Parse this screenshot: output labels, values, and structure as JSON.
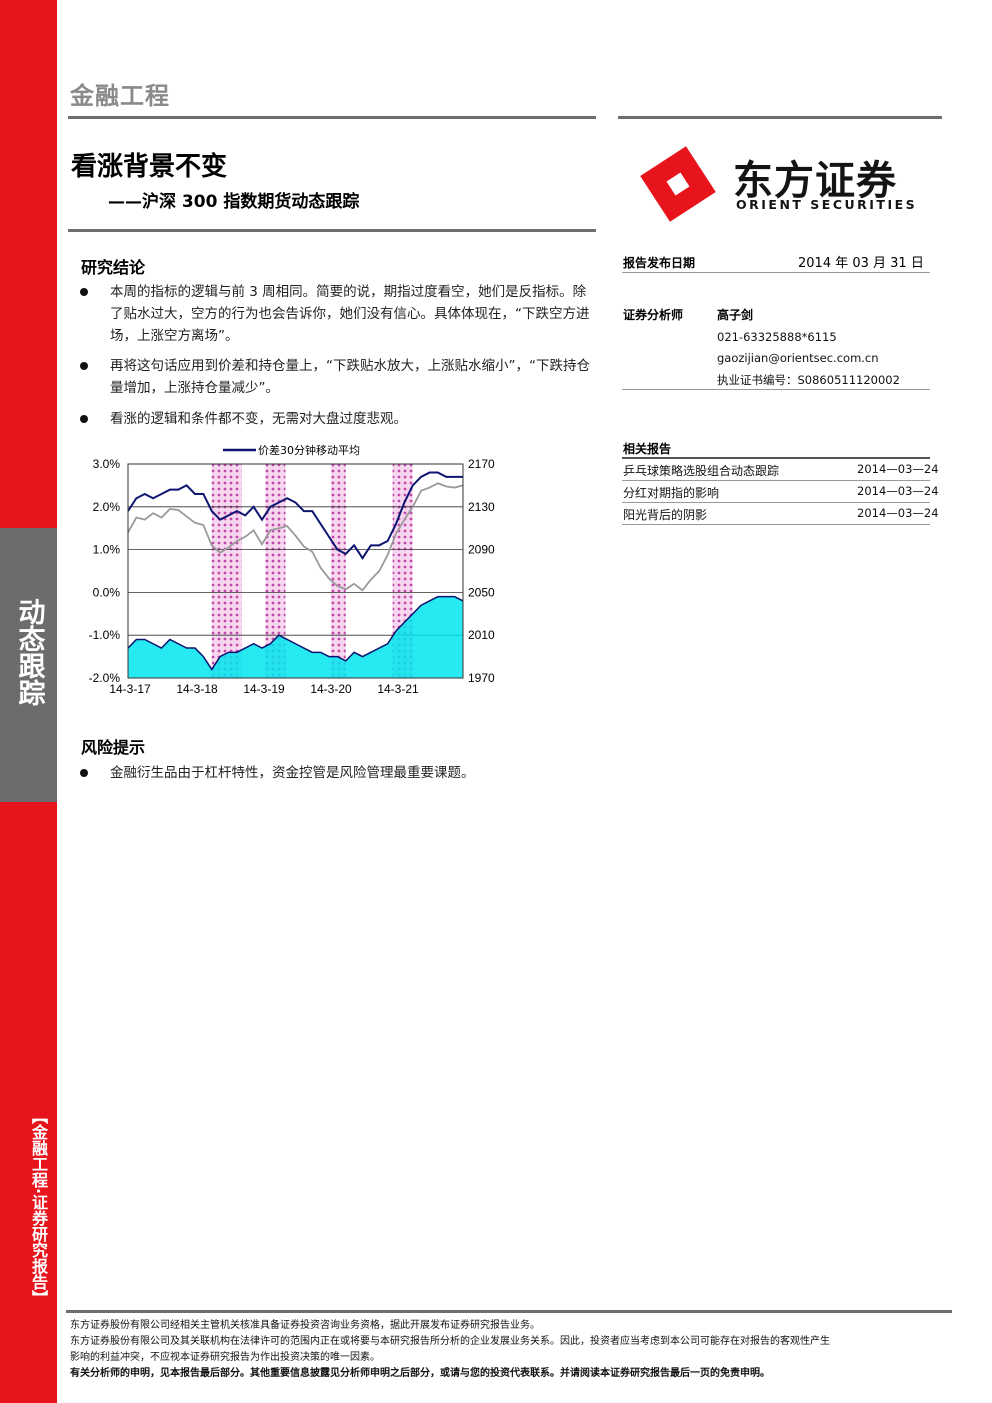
{
  "header": {
    "category": "金融工程",
    "title": "看涨背景不变",
    "subtitle": "——沪深 300 指数期货动态跟踪"
  },
  "logo": {
    "name_cn": "东方证券",
    "name_en": "ORIENT SECURITIES",
    "brand_color": "#e8141c"
  },
  "sidebar": {
    "tab_label": "动态跟踪",
    "category_label": "【金融工程·证券研究报告】"
  },
  "conclusion": {
    "title": "研究结论",
    "bullets": [
      "本周的指标的逻辑与前 3 周相同。简要的说，期指过度看空，她们是反指标。除了贴水过大，空方的行为也会告诉你，她们没有信心。具体体现在，“下跌空方进场，上涨空方离场”。",
      "再将这句话应用到价差和持仓量上，“下跌贴水放大，上涨贴水缩小”，“下跌持仓量增加，上涨持仓量减少”。",
      "看涨的逻辑和条件都不变，无需对大盘过度悲观。"
    ]
  },
  "risk": {
    "title": "风险提示",
    "bullets": [
      "金融衍生品由于杠杆特性，资金控管是风险管理最重要课题。"
    ]
  },
  "report_info": {
    "date_label": "报告发布日期",
    "date_value": "2014 年 03 月 31 日",
    "analyst_label": "证券分析师",
    "analyst_name": "高子剑",
    "phone": "021-63325888*6115",
    "email": "gaozijian@orientsec.com.cn",
    "license": "执业证书编号：S0860511120002"
  },
  "related": {
    "title": "相关报告",
    "items": [
      {
        "title": "乒乓球策略选股组合动态跟踪",
        "date": "2014—03—24"
      },
      {
        "title": "分红对期指的影响",
        "date": "2014—03—24"
      },
      {
        "title": "阳光背后的阴影",
        "date": "2014—03—24"
      }
    ]
  },
  "chart_data": {
    "type": "line",
    "legend": [
      "价差30分钟移动平均"
    ],
    "x_tick_labels": [
      "14-3-17",
      "14-3-18",
      "14-3-19",
      "14-3-20",
      "14-3-21"
    ],
    "y_left": {
      "ticks": [
        "3.0%",
        "2.0%",
        "1.0%",
        "0.0%",
        "-1.0%",
        "-2.0%"
      ],
      "range": [
        -2.0,
        3.0
      ]
    },
    "y_right": {
      "ticks": [
        "2170",
        "2130",
        "2090",
        "2050",
        "2010",
        "1970"
      ],
      "range": [
        1970,
        2170
      ]
    },
    "highlight_spans": [
      [
        0.5,
        0.68
      ],
      [
        0.82,
        0.94
      ],
      [
        1.21,
        1.3
      ],
      [
        1.58,
        1.7
      ]
    ],
    "x": [
      0,
      0.05,
      0.1,
      0.15,
      0.2,
      0.25,
      0.3,
      0.35,
      0.4,
      0.45,
      0.5,
      0.55,
      0.6,
      0.65,
      0.7,
      0.75,
      0.8,
      0.85,
      0.9,
      0.95,
      1.0,
      1.05,
      1.1,
      1.15,
      1.2,
      1.25,
      1.3,
      1.35,
      1.4,
      1.45,
      1.5,
      1.55,
      1.6,
      1.65,
      1.7,
      1.75,
      1.8,
      1.85,
      1.9,
      1.95,
      2.0
    ],
    "series": [
      {
        "name": "价差30分钟移动平均",
        "color": "#0d1570",
        "values": [
          1.9,
          2.2,
          2.3,
          2.2,
          2.3,
          2.4,
          2.4,
          2.5,
          2.3,
          2.3,
          1.9,
          1.7,
          1.8,
          1.9,
          1.8,
          2.0,
          1.7,
          2.0,
          2.1,
          2.2,
          2.1,
          1.9,
          1.9,
          1.6,
          1.3,
          1.0,
          0.9,
          1.1,
          0.8,
          1.1,
          1.1,
          1.2,
          1.6,
          2.1,
          2.5,
          2.7,
          2.8,
          2.8,
          2.7,
          2.7,
          2.7
        ]
      },
      {
        "color": "#9a9a9a",
        "values": [
          2106,
          2120,
          2118,
          2124,
          2120,
          2128,
          2127,
          2121,
          2115,
          2113,
          2094,
          2087,
          2092,
          2098,
          2102,
          2108,
          2095,
          2108,
          2110,
          2112,
          2103,
          2093,
          2088,
          2073,
          2063,
          2056,
          2053,
          2058,
          2052,
          2062,
          2070,
          2085,
          2105,
          2118,
          2130,
          2145,
          2148,
          2152,
          2149,
          2148,
          2150
        ]
      },
      {
        "color": "#00e5ee",
        "values": [
          -1.3,
          -1.1,
          -1.1,
          -1.2,
          -1.3,
          -1.1,
          -1.2,
          -1.3,
          -1.3,
          -1.5,
          -1.8,
          -1.5,
          -1.4,
          -1.4,
          -1.3,
          -1.2,
          -1.3,
          -1.2,
          -1.0,
          -1.1,
          -1.2,
          -1.3,
          -1.4,
          -1.4,
          -1.5,
          -1.5,
          -1.6,
          -1.4,
          -1.5,
          -1.4,
          -1.3,
          -1.2,
          -0.9,
          -0.7,
          -0.5,
          -0.3,
          -0.2,
          -0.1,
          -0.1,
          -0.1,
          -0.2
        ]
      }
    ]
  },
  "footer": {
    "line1": "东方证券股份有限公司经相关主管机关核准具备证券投资咨询业务资格，据此开展发布证券研究报告业务。",
    "line2": "东方证券股份有限公司及其关联机构在法律许可的范围内正在或将要与本研究报告所分析的企业发展业务关系。因此，投资者应当考虑到本公司可能存在对报告的客观性产生",
    "line3": "影响的利益冲突，不应视本证券研究报告为作出投资决策的唯一因素。",
    "line4": "有关分析师的申明，见本报告最后部分。其他重要信息披露见分析师申明之后部分，或请与您的投资代表联系。并请阅读本证券研究报告最后一页的免责申明。"
  }
}
